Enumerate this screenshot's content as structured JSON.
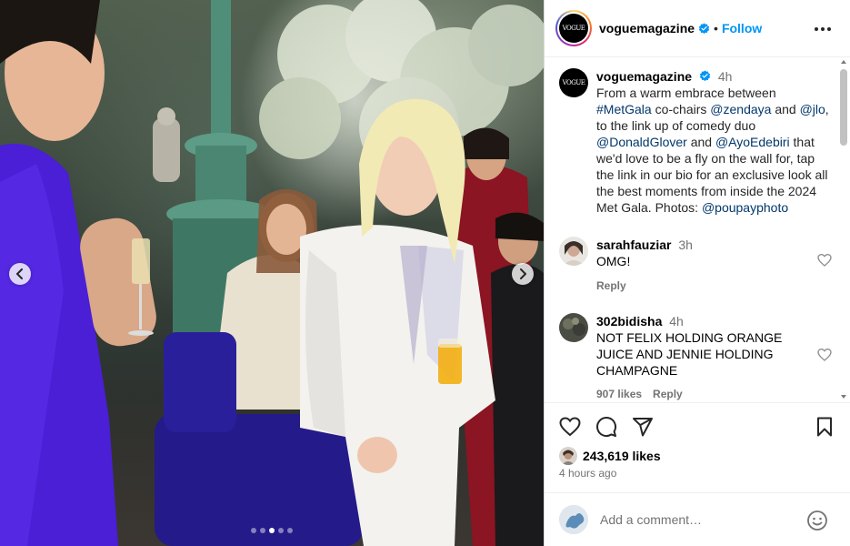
{
  "header": {
    "username": "voguemagazine",
    "separator": "•",
    "follow_label": "Follow",
    "logo_text": "VOGUE"
  },
  "carousel": {
    "slide_count": 5,
    "active_index": 2
  },
  "caption": {
    "username": "voguemagazine",
    "time": "4h",
    "parts": [
      {
        "text": "From a warm embrace between ",
        "link": false
      },
      {
        "text": "#MetGala",
        "link": true
      },
      {
        "text": " co-chairs ",
        "link": false
      },
      {
        "text": "@zendaya",
        "link": true
      },
      {
        "text": " and ",
        "link": false
      },
      {
        "text": "@jlo",
        "link": true
      },
      {
        "text": ", to the link up of comedy duo ",
        "link": false
      },
      {
        "text": "@DonaldGlover",
        "link": true
      },
      {
        "text": " and ",
        "link": false
      },
      {
        "text": "@AyoEdebiri",
        "link": true
      },
      {
        "text": " that we'd love to be a fly on the wall for, tap the link in our bio for an exclusive look all the best moments from inside the 2024 Met Gala. Photos: ",
        "link": false
      },
      {
        "text": "@poupayphoto",
        "link": true
      }
    ]
  },
  "comments": [
    {
      "username": "sarahfauziar",
      "time": "3h",
      "text": "OMG!",
      "likes": "",
      "reply_label": "Reply"
    },
    {
      "username": "302bidisha",
      "time": "4h",
      "text": "NOT FELIX HOLDING ORANGE JUICE AND JENNIE HOLDING CHAMPAGNE",
      "likes": "907 likes",
      "reply_label": "Reply"
    }
  ],
  "engagement": {
    "likes": "243,619 likes",
    "posted": "4 hours ago"
  },
  "add_comment": {
    "placeholder": "Add a comment…"
  },
  "colors": {
    "accent": "#0095f6",
    "link": "#00376b",
    "secondary_text": "#737373",
    "verified": "#0095f6"
  },
  "icons": [
    "chevron-left-icon",
    "chevron-right-icon",
    "verified-badge-icon",
    "more-options-icon",
    "heart-icon",
    "comment-icon",
    "share-icon",
    "bookmark-icon",
    "emoji-icon"
  ]
}
